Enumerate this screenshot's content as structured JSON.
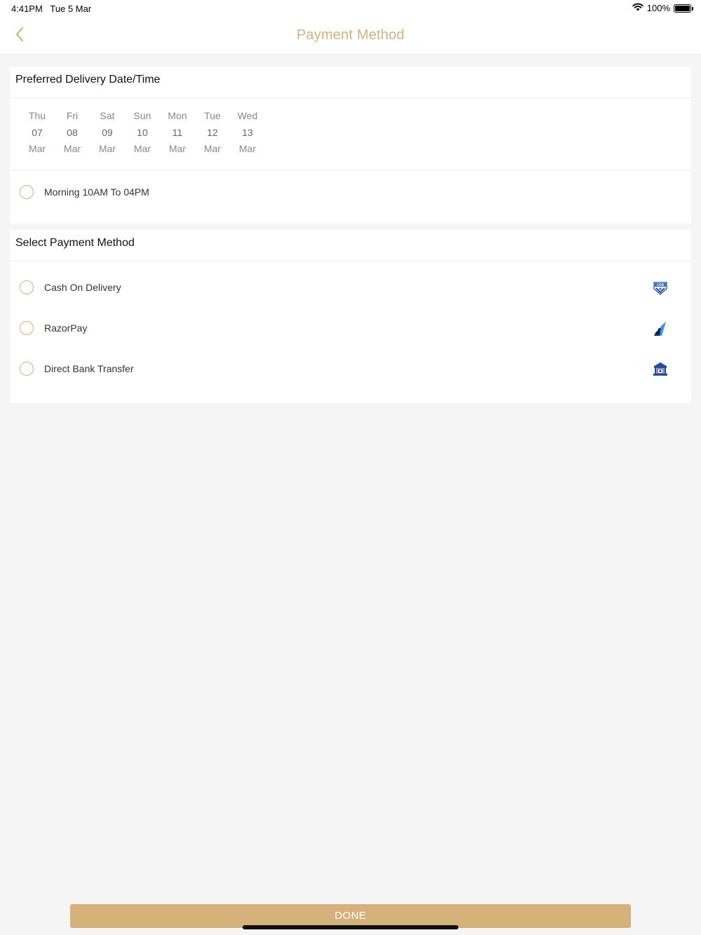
{
  "status_bar": {
    "time": "4:41PM",
    "date": "Tue 5 Mar",
    "battery": "100%"
  },
  "nav": {
    "title": "Payment Method",
    "back_icon": "chevron-left-icon"
  },
  "delivery": {
    "header": "Preferred Delivery Date/Time",
    "dates": [
      {
        "day": "Thu",
        "num": "07",
        "month": "Mar"
      },
      {
        "day": "Fri",
        "num": "08",
        "month": "Mar"
      },
      {
        "day": "Sat",
        "num": "09",
        "month": "Mar"
      },
      {
        "day": "Sun",
        "num": "10",
        "month": "Mar"
      },
      {
        "day": "Mon",
        "num": "11",
        "month": "Mar"
      },
      {
        "day": "Tue",
        "num": "12",
        "month": "Mar"
      },
      {
        "day": "Wed",
        "num": "13",
        "month": "Mar"
      }
    ],
    "time_slot": "Morning 10AM To 04PM"
  },
  "payment": {
    "header": "Select Payment Method",
    "methods": [
      {
        "label": "Cash On Delivery",
        "icon": "cash-on-delivery-icon"
      },
      {
        "label": "RazorPay",
        "icon": "razorpay-icon"
      },
      {
        "label": "Direct Bank Transfer",
        "icon": "bank-icon"
      }
    ]
  },
  "done_label": "DONE",
  "colors": {
    "accent": "#d4b27a",
    "background": "#f5f5f5",
    "card": "#ffffff"
  }
}
